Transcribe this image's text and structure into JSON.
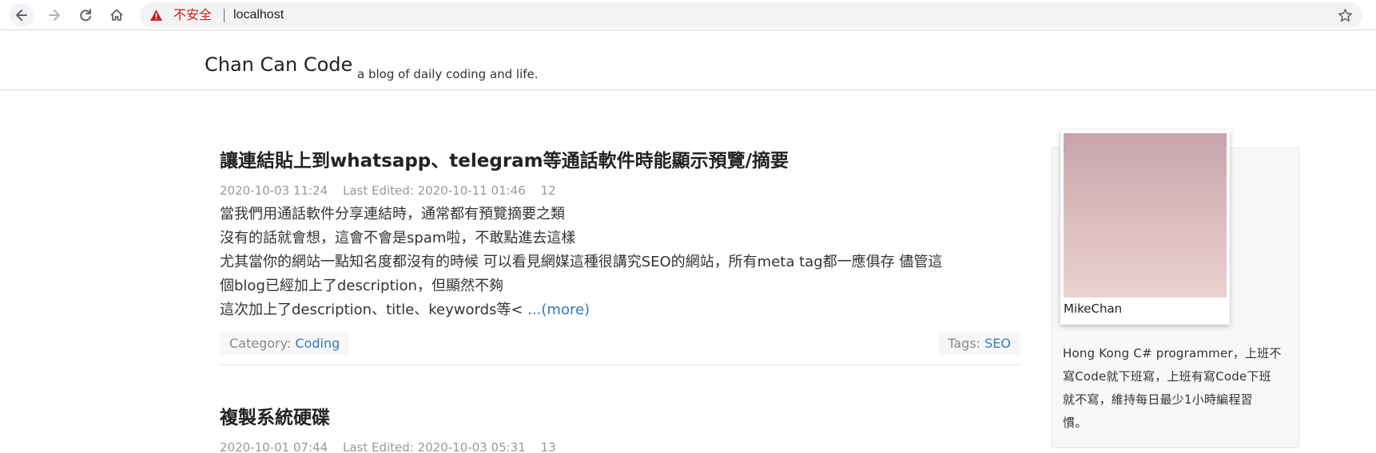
{
  "browser": {
    "security_label": "不安全",
    "url": "localhost",
    "icons": {
      "back": "arrow-left-icon",
      "forward": "arrow-right-icon",
      "reload": "reload-icon",
      "home": "home-icon",
      "warning": "warning-triangle-icon",
      "bookmark": "star-icon"
    },
    "colors": {
      "insecure": "#c5221f"
    }
  },
  "site": {
    "title": "Chan Can Code",
    "tagline": "a blog of daily coding and life."
  },
  "posts": [
    {
      "title": "讓連結貼上到whatsapp、telegram等通話軟件時能顯示預覽/摘要",
      "date": "2020-10-03 11:24",
      "edited": "Last Edited: 2020-10-11 01:46",
      "views": "12",
      "summary_lines": [
        "當我們用通話軟件分享連結時，通常都有預覽摘要之類",
        "沒有的話就會想，這會不會是spam啦，不敢點進去這樣",
        "尤其當你的網站一點知名度都沒有的時候 可以看見網媒這種很講究SEO的網站，所有meta tag都一應俱存 儘管這",
        "個blog已經加上了description，但顯然不夠",
        "這次加上了description、title、keywords等< "
      ],
      "more_label": "...(more)",
      "category_label": "Category: ",
      "category": "Coding",
      "tags_label": "Tags: ",
      "tags": "SEO"
    },
    {
      "title": "複製系統硬碟",
      "date": "2020-10-01 07:44",
      "edited": "Last Edited: 2020-10-03 05:31",
      "views": "13"
    }
  ],
  "sidebar": {
    "profile_name": "MikeChan",
    "bio_lines": [
      "Hong Kong C# programmer，上班不",
      "寫Code就下班寫，上班有寫Code下班",
      "就不寫，維持每日最少1小時編程習",
      "慣。"
    ]
  },
  "colors": {
    "link": "#337ab7",
    "meta": "#999999",
    "sidebar_bg": "#f7f8f8"
  }
}
